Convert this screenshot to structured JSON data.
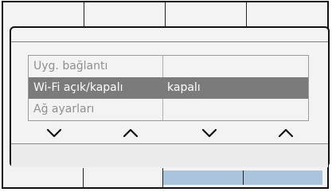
{
  "menu": {
    "rows": [
      {
        "label": "Uyg. bağlantı",
        "value": ""
      },
      {
        "label": "Wi-Fi açık/kapalı",
        "value": "kapalı"
      },
      {
        "label": "Ağ ayarları",
        "value": ""
      }
    ],
    "selected_index": 1
  },
  "nav": {
    "icons": [
      "chevron-down-icon",
      "chevron-up-icon",
      "chevron-down-icon",
      "chevron-up-icon"
    ]
  },
  "colors": {
    "selected_row": "#7b7b7b",
    "active_softkey": "#a9c4dc",
    "frame": "#111111",
    "background": "#f3f3f3"
  }
}
